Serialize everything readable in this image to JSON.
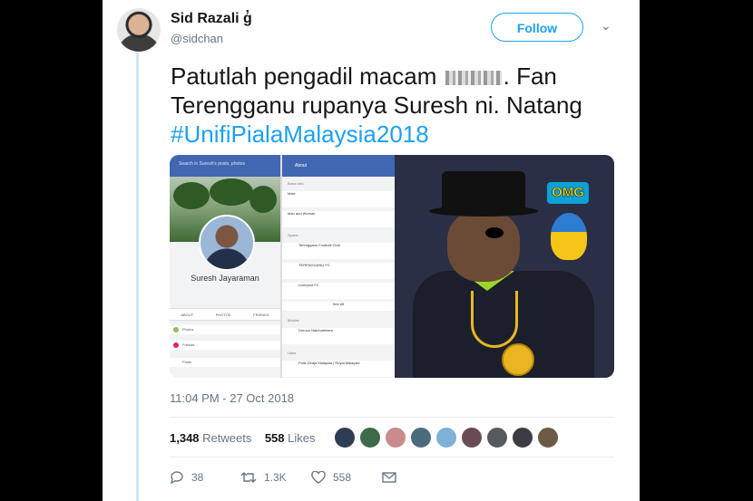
{
  "tweet": {
    "display_name": "Sid Razali",
    "name_suffix": "ɡ̓",
    "handle": "@sidchan",
    "follow_label": "Follow",
    "text_part1": "Patutlah pengadil macam",
    "text_part2": ". Fan Terengganu rupanya Suresh ni. Natang",
    "hashtag": "#UnifiPialaMalaysia2018",
    "timestamp": "11:04 PM - 27 Oct 2018"
  },
  "media": {
    "fb_search": "Search in Suresh's posts, photos",
    "profile_name": "Suresh Jayaraman",
    "profile_tabs": [
      "ABOUT",
      "PHOTOS",
      "FRIENDS"
    ],
    "profile_rows": [
      "Photos",
      "Friends",
      "Posts"
    ],
    "about_title": "About",
    "about_sections": [
      {
        "head": "Basic Info",
        "rows": [
          "Male",
          "Man and Woman"
        ]
      },
      {
        "head": "Sports",
        "rows": [
          "Terengganu Football Club",
          "TERENGGANU FC",
          "Liverpool FC"
        ]
      },
      {
        "head": "Movies",
        "rows": [
          "Dhruva Natchathiram"
        ]
      },
      {
        "head": "Likes",
        "rows": [
          "Polis Diraja Malaysia | Royal Malaysia"
        ]
      }
    ],
    "see_all": "See All",
    "meme_text": "OMG"
  },
  "stats": {
    "retweets_count": "1,348",
    "retweets_label": "Retweets",
    "likes_count": "558",
    "likes_label": "Likes"
  },
  "actions": {
    "reply_count": "38",
    "retweet_count": "1.3K",
    "like_count": "558"
  },
  "colors": {
    "accent": "#1da1f2",
    "text": "#14171a",
    "muted": "#657786",
    "facebook_blue": "#4267b2"
  },
  "icons": [
    "chevron-down-icon",
    "reply-icon",
    "retweet-icon",
    "heart-icon",
    "message-icon"
  ]
}
